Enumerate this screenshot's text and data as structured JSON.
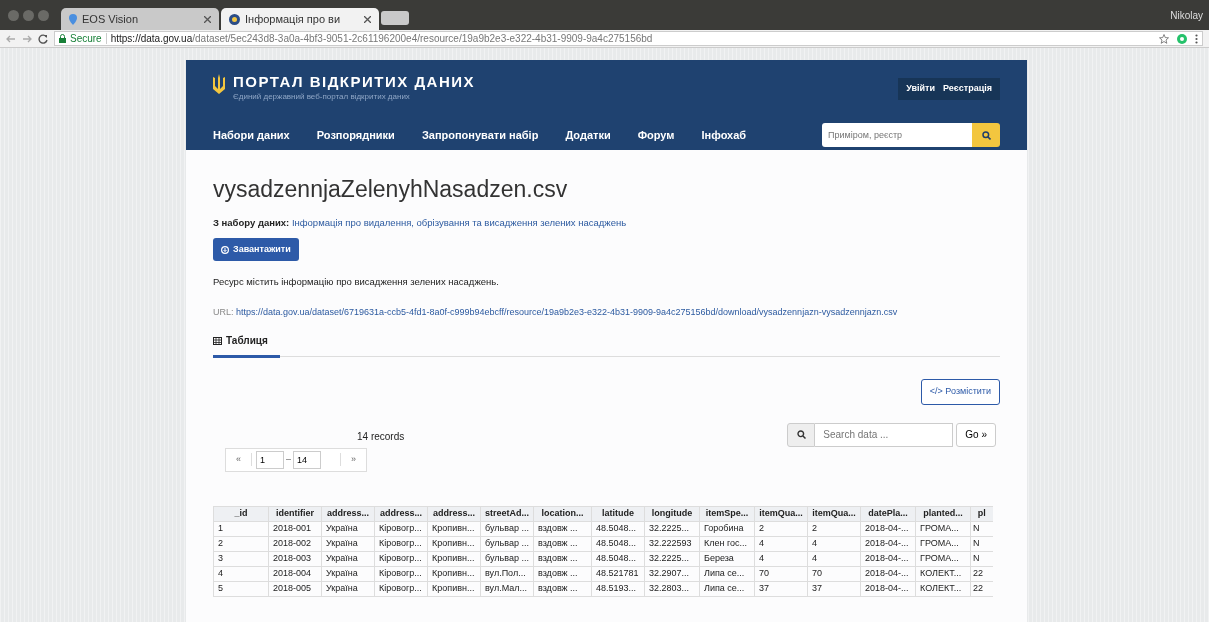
{
  "browser": {
    "tabs": [
      {
        "title": "EOS Vision",
        "selected": false
      },
      {
        "title": "Інформація про ви",
        "selected": true
      }
    ],
    "user": "Nikolay",
    "secure_label": "Secure",
    "url_host": "https://data.gov.ua",
    "url_path": "/dataset/5ec243d8-3a0a-4bf3-9051-2c61196200e4/resource/19a9b2e3-e322-4b31-9909-9a4c275156bd"
  },
  "header": {
    "title": "ПОРТАЛ ВІДКРИТИХ ДАНИХ",
    "subtitle": "Єдиний державний веб-портал відкритих даних",
    "auth": [
      "Увійти",
      "Реєстрація"
    ],
    "nav": [
      "Набори даних",
      "Розпорядники",
      "Запропонувати набір",
      "Додатки",
      "Форум",
      "Інфохаб"
    ],
    "search": {
      "placeholder": "Приміром, реєстр"
    }
  },
  "resource": {
    "title": "vysadzennjaZelenyhNasadzen.csv",
    "dataset_label": "З набору даних:",
    "dataset_link": "Інформація про видалення, обрізування та висадження зелених насаджень",
    "download": "Завантажити",
    "description": "Ресурс містить інформацію про висадження зелених насаджень.",
    "url_label": "URL:",
    "url": "https://data.gov.ua/dataset/6719631a-ccb5-4fd1-8a0f-c999b94ebcff/resource/19a9b2e3-e322-4b31-9909-9a4c275156bd/download/vysadzennjazn-vysadzennjazn.csv"
  },
  "view_tabs": [
    {
      "label": "Таблиця",
      "selected": true
    }
  ],
  "embed": "</> Розмістити",
  "grid": {
    "records": "14 records",
    "search": {
      "placeholder": "Search data ..."
    },
    "go": "Go »",
    "pager": {
      "prev": "«",
      "from": "1",
      "sep": "–",
      "to": "14",
      "next": "»"
    },
    "columns": [
      "_id",
      "identifier",
      "address...",
      "address...",
      "address...",
      "streetAd...",
      "location...",
      "latitude",
      "longitude",
      "itemSpe...",
      "itemQua...",
      "itemQua...",
      "datePla...",
      "planted...",
      "pl"
    ],
    "rows": [
      [
        "1",
        "2018-001",
        "Україна",
        "Кіровогр...",
        "Кропивн...",
        "бульвар ...",
        "вздовж ...",
        "48.5048...",
        "32.2225...",
        "Горобина",
        "2",
        "2",
        "2018-04-...",
        "ГРОМА...",
        "N"
      ],
      [
        "2",
        "2018-002",
        "Україна",
        "Кіровогр...",
        "Кропивн...",
        "бульвар ...",
        "вздовж ...",
        "48.5048...",
        "32.222593",
        "Клен гос...",
        "4",
        "4",
        "2018-04-...",
        "ГРОМА...",
        "N"
      ],
      [
        "3",
        "2018-003",
        "Україна",
        "Кіровогр...",
        "Кропивн...",
        "бульвар ...",
        "вздовж ...",
        "48.5048...",
        "32.2225...",
        "Береза",
        "4",
        "4",
        "2018-04-...",
        "ГРОМА...",
        "N"
      ],
      [
        "4",
        "2018-004",
        "Україна",
        "Кіровогр...",
        "Кропивн...",
        "вул.Пол...",
        "вздовж ...",
        "48.521781",
        "32.2907...",
        "Липа се...",
        "70",
        "70",
        "2018-04-...",
        "КОЛЕКТ...",
        "22"
      ],
      [
        "5",
        "2018-005",
        "Україна",
        "Кіровогр...",
        "Кропивн...",
        "вул.Мал...",
        "вздовж ...",
        "48.5193...",
        "32.2803...",
        "Липа се...",
        "37",
        "37",
        "2018-04-...",
        "КОЛЕКТ...",
        "22"
      ]
    ]
  }
}
